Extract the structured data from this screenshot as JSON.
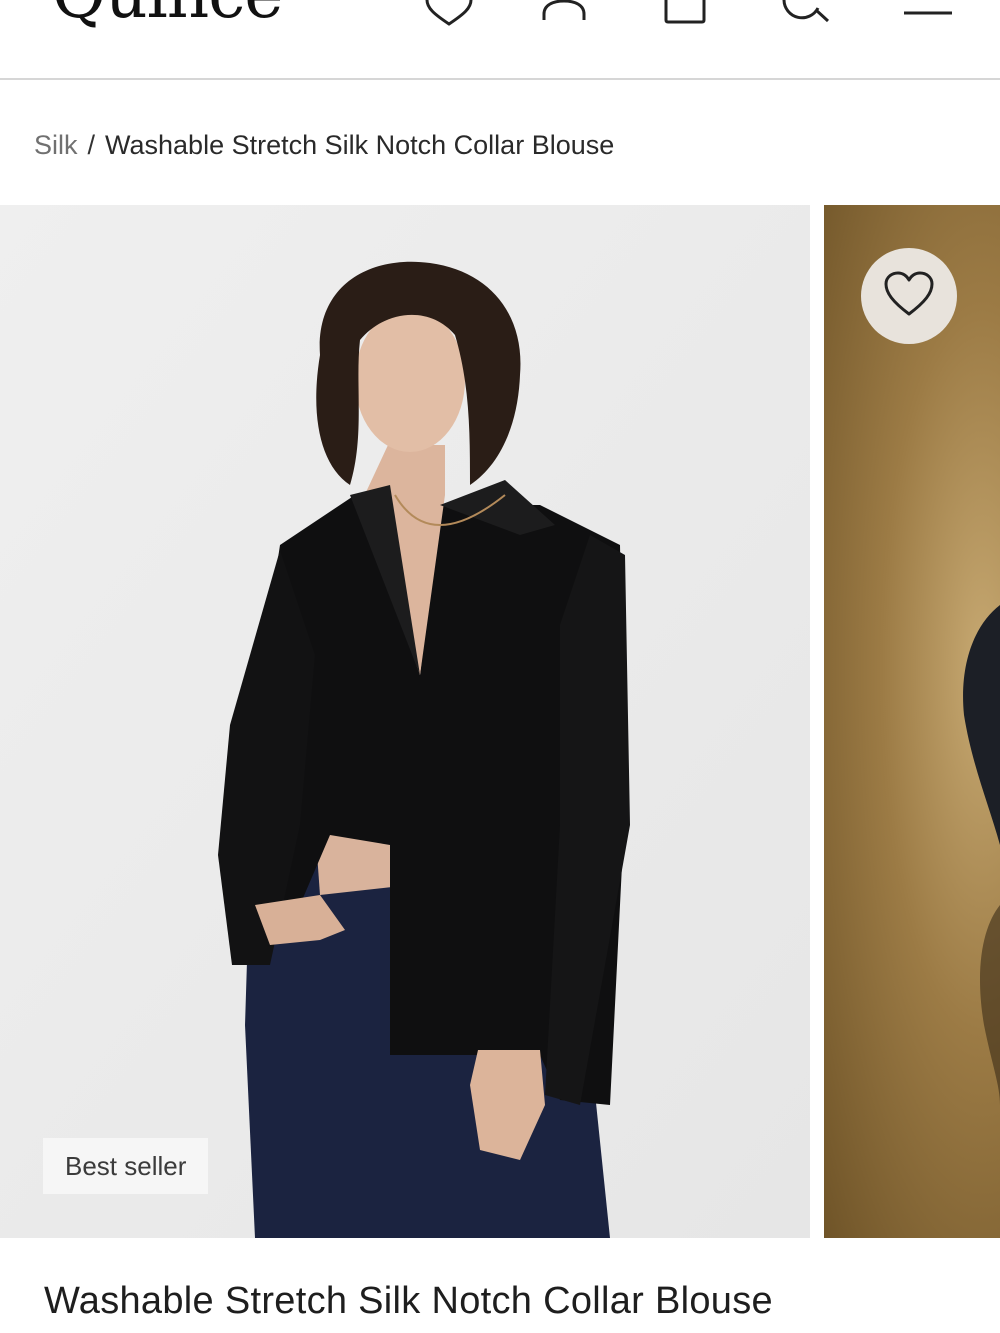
{
  "header": {
    "logo": "Quince",
    "icons": [
      "heart-icon",
      "account-icon",
      "bag-icon",
      "search-icon",
      "menu-icon"
    ]
  },
  "breadcrumb": {
    "parent": "Silk",
    "separator": "/",
    "current": "Washable Stretch Silk Notch Collar Blouse"
  },
  "gallery": {
    "badge": "Best seller",
    "wishlist_icon": "heart-icon"
  },
  "product": {
    "title": "Washable Stretch Silk Notch Collar Blouse"
  },
  "colors": {
    "text": "#222222",
    "muted": "#707070",
    "image_bg": "#ececec",
    "wishlist_bg": "#e8e3dc"
  }
}
